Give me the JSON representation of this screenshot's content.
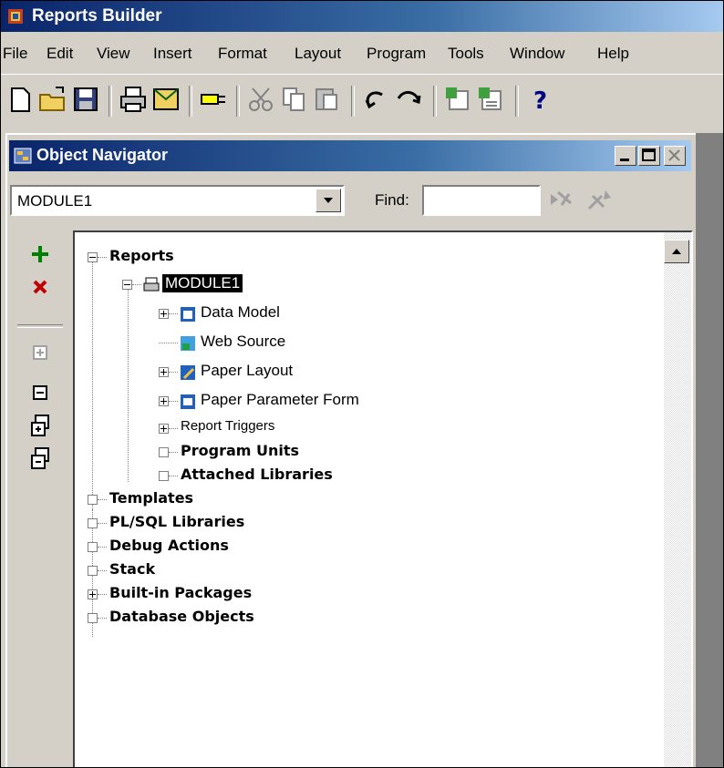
{
  "app": {
    "title": "Reports Builder"
  },
  "menu": [
    "File",
    "Edit",
    "View",
    "Insert",
    "Format",
    "Layout",
    "Program",
    "Tools",
    "Window",
    "Help"
  ],
  "navigator": {
    "title": "Object Navigator",
    "module_selected": "MODULE1",
    "find_label": "Find:",
    "find_value": ""
  },
  "tree": {
    "reports": "Reports",
    "module": "MODULE1",
    "data_model": "Data Model",
    "web_source": "Web Source",
    "paper_layout": "Paper Layout",
    "paper_param_form": "Paper Parameter Form",
    "report_triggers": "Report Triggers",
    "program_units": "Program Units",
    "attached_libraries": "Attached Libraries",
    "templates": "Templates",
    "plsql_libraries": "PL/SQL Libraries",
    "debug_actions": "Debug Actions",
    "stack": "Stack",
    "builtin_packages": "Built-in Packages",
    "database_objects": "Database Objects"
  },
  "colors": {
    "titlebar": "#0a246a",
    "face": "#d4d0c8",
    "workspace": "#808080"
  }
}
